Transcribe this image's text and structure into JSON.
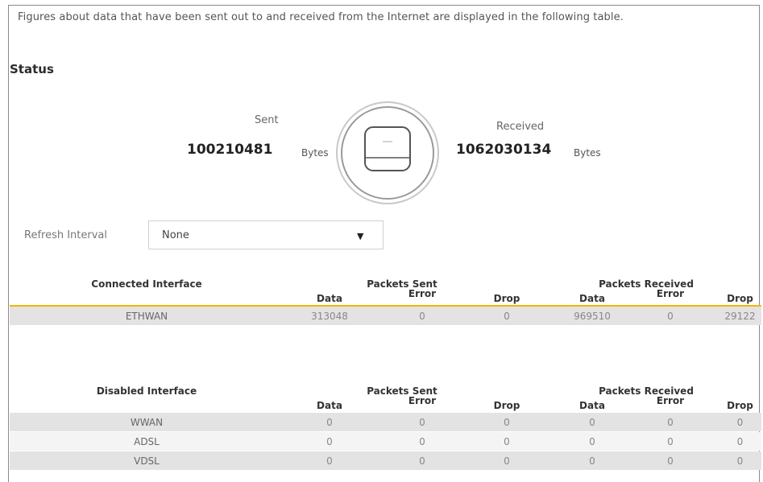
{
  "intro_text": "Figures about data that have been sent out to and received from the Internet are displayed in the following table.",
  "section_title": "Status",
  "sent": {
    "label": "Sent",
    "value": "100210481",
    "unit": "Bytes"
  },
  "received": {
    "label": "Received",
    "value": "1062030134",
    "unit": "Bytes"
  },
  "refresh": {
    "label": "Refresh Interval",
    "selected": "None"
  },
  "column_headers": {
    "packets_sent": "Packets Sent",
    "packets_received": "Packets Received",
    "data": "Data",
    "error": "Error",
    "drop": "Drop"
  },
  "connected": {
    "header": "Connected Interface",
    "rows": [
      {
        "name": "ETHWAN",
        "sent_data": "313048",
        "sent_error": "0",
        "sent_drop": "0",
        "recv_data": "969510",
        "recv_error": "0",
        "recv_drop": "29122"
      }
    ]
  },
  "disabled": {
    "header": "Disabled Interface",
    "rows": [
      {
        "name": "WWAN",
        "sent_data": "0",
        "sent_error": "0",
        "sent_drop": "0",
        "recv_data": "0",
        "recv_error": "0",
        "recv_drop": "0"
      },
      {
        "name": "ADSL",
        "sent_data": "0",
        "sent_error": "0",
        "sent_drop": "0",
        "recv_data": "0",
        "recv_error": "0",
        "recv_drop": "0"
      },
      {
        "name": "VDSL",
        "sent_data": "0",
        "sent_error": "0",
        "sent_drop": "0",
        "recv_data": "0",
        "recv_error": "0",
        "recv_drop": "0"
      }
    ]
  },
  "colors": {
    "accent_line": "#f5b400",
    "row_shade": "#e3e3e3"
  }
}
